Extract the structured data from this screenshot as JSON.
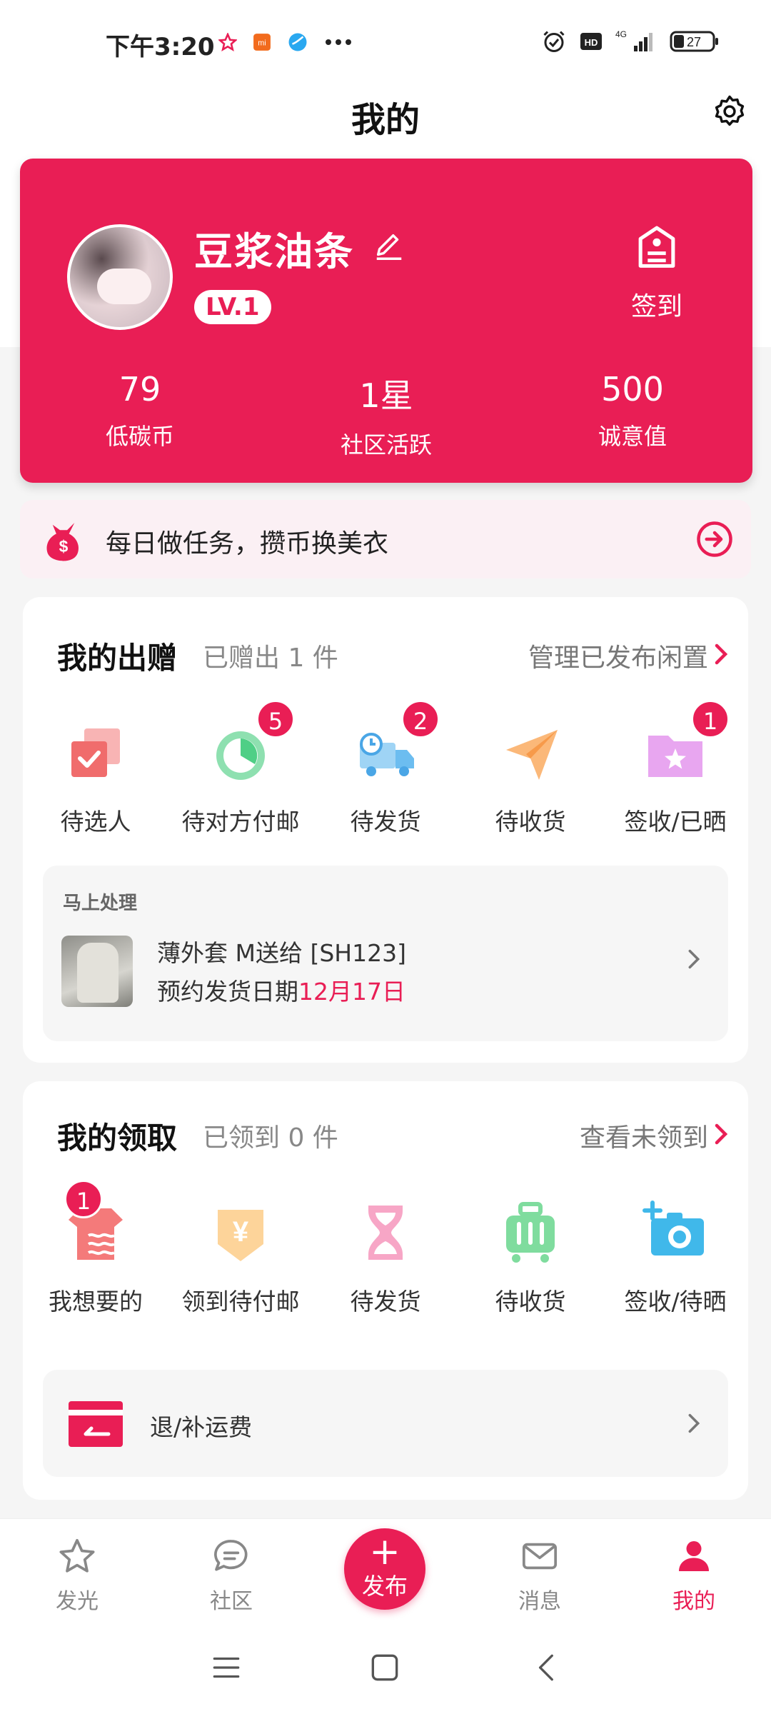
{
  "status_bar": {
    "time": "下午3:20",
    "battery": "27",
    "network": "4G",
    "hd": "HD"
  },
  "header": {
    "title": "我的"
  },
  "profile": {
    "name": "豆浆油条",
    "level": "LV.1",
    "checkin_label": "签到",
    "stats": [
      {
        "value": "79",
        "label": "低碳币"
      },
      {
        "value": "1星",
        "label": "社区活跃"
      },
      {
        "value": "500",
        "label": "诚意值"
      }
    ]
  },
  "task_banner": {
    "text": "每日做任务，攒币换美衣"
  },
  "gifts": {
    "title": "我的出赠",
    "subtitle": "已赠出 1 件",
    "link": "管理已发布闲置",
    "items": [
      {
        "label": "待选人",
        "icon": "select-person-icon",
        "badge": ""
      },
      {
        "label": "待对方付邮",
        "icon": "pending-postage-icon",
        "badge": "5"
      },
      {
        "label": "待发货",
        "icon": "shipping-truck-icon",
        "badge": "2"
      },
      {
        "label": "待收货",
        "icon": "paper-plane-icon",
        "badge": ""
      },
      {
        "label": "签收/已晒",
        "icon": "folder-star-icon",
        "badge": "1"
      }
    ],
    "pending": {
      "heading": "马上处理",
      "line1": "薄外套 M送给 [SH123]",
      "line2_prefix": "预约发货日期",
      "line2_date": "12月17日"
    }
  },
  "receipts": {
    "title": "我的领取",
    "subtitle": "已领到 0 件",
    "link": "查看未领到",
    "items": [
      {
        "label": "我想要的",
        "icon": "wishlist-shirt-icon",
        "badge": "1"
      },
      {
        "label": "领到待付邮",
        "icon": "yuan-tag-icon",
        "badge": ""
      },
      {
        "label": "待发货",
        "icon": "hourglass-icon",
        "badge": ""
      },
      {
        "label": "待收货",
        "icon": "luggage-icon",
        "badge": ""
      },
      {
        "label": "签收/待晒",
        "icon": "camera-plus-icon",
        "badge": ""
      }
    ],
    "refund_label": "退/补运费"
  },
  "tabbar": {
    "items": [
      {
        "label": "发光",
        "icon": "star-icon"
      },
      {
        "label": "社区",
        "icon": "chat-icon"
      },
      {
        "label": "发布",
        "icon": "plus-icon"
      },
      {
        "label": "消息",
        "icon": "mail-icon"
      },
      {
        "label": "我的",
        "icon": "person-icon"
      }
    ],
    "active": "我的"
  },
  "colors": {
    "accent": "#e91e55"
  }
}
